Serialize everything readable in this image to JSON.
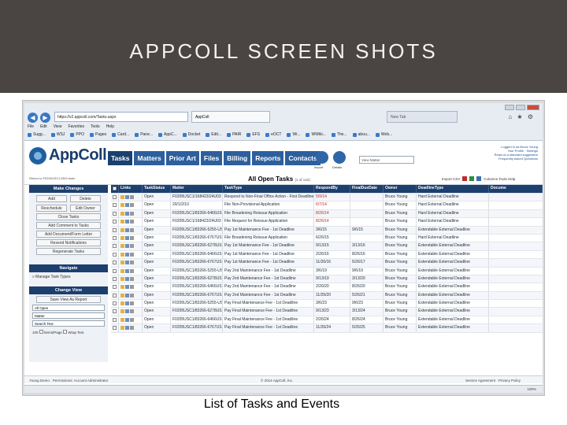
{
  "slide": {
    "title": "APPCOLL SCREEN SHOTS",
    "caption": "List of Tasks and Events"
  },
  "browser": {
    "url": "https://v2.appcoll.com/Tasks.aspx",
    "tab_title": "AppColl",
    "tab_new": "New Tab",
    "menu": [
      "File",
      "Edit",
      "View",
      "Favorites",
      "Tools",
      "Help"
    ],
    "favorites": [
      "Sugg...",
      "WSJ",
      "PPO",
      "Pages",
      "Card...",
      "Pane...",
      "AppC...",
      "Docket",
      "Edit...",
      "PAIR",
      "EFS",
      "eOCT",
      "Wi...",
      "WWiki...",
      "The...",
      "abou...",
      "Web..."
    ]
  },
  "app": {
    "logo_text": "AppColl",
    "tabs": [
      "Tasks",
      "Matters",
      "Prior Art",
      "Files",
      "Billing",
      "Reports",
      "Contacts"
    ],
    "import_label": "Import",
    "details_label": "Details",
    "search_placeholder": "View Matter",
    "user": {
      "logged_in": "Logged in as Bruce Young",
      "profile": "Your Profile · Settings",
      "support": "Read us a standard suggestion",
      "faq": "Frequently Asked Questions"
    },
    "return_link": "Return to F0205USC1/26/5 Aster",
    "list_title": "All Open Tasks",
    "list_count": "(1 of 142)",
    "list_tools": "Import CSV",
    "list_options": "Columns  Tools  Help"
  },
  "sidebar": {
    "make_changes": "Make Changes",
    "add": "Add",
    "delete": "Delete",
    "reschedule": "Reschedule",
    "edit_owner": "Edit Owner",
    "close_tasks": "Close Tasks",
    "add_comment": "Add Comment to Tasks",
    "add_document": "Add Document/Form Letter",
    "resend": "Resend Notifications",
    "regenerate": "Regenerate Tasks",
    "navigate": "Navigate",
    "manage_types": "Manage Task Types",
    "change_view": "Change View",
    "save_view": "Save View As Report",
    "filter_all": "All Open",
    "filter_matter": "Matter",
    "search_text": "Search Text",
    "rows_per_page": "100",
    "items_per_page": "Items/Page",
    "wrap_text": "Wrap Text"
  },
  "table": {
    "headers": [
      "",
      "Links",
      "TaskStatus",
      "Matter",
      "TaskType",
      "RespondBy",
      "FinalDueDate",
      "Owner",
      "DeadlineType",
      "Docume"
    ],
    "rows": [
      {
        "status": "Open",
        "matter": "F0205USC1/168423/24U03",
        "type": "Respond to Non-Final Office Action - First Deadline",
        "by": "5/9/14",
        "final": "",
        "owner": "Bruce Young",
        "dtype": "Hard External Deadline"
      },
      {
        "status": "Open",
        "matter": "20/1/2/10",
        "type": "File Non-Provisional Application",
        "by": "6/7/14",
        "final": "",
        "owner": "Bruce Young",
        "dtype": "Hard External Deadline"
      },
      {
        "status": "Open",
        "matter": "F0205USC1/83266-6466US",
        "type": "File Broadening Reissue Application",
        "by": "8/26/14",
        "final": "",
        "owner": "Bruce Young",
        "dtype": "Hard External Deadline"
      },
      {
        "status": "Open",
        "matter": "F0205USC1/168423/24U03",
        "type": "File Request for Reissue Application",
        "by": "8/26/14",
        "final": "",
        "owner": "Bruce Young",
        "dtype": "Hard External Deadline"
      },
      {
        "status": "Open",
        "matter": "F0205USC1/83266-5255-US",
        "type": "Pay 1st Maintenance Fee - 1st Deadline",
        "by": "3/6/15",
        "final": "9/6/15",
        "owner": "Bruce Young",
        "dtype": "Extendable External Deadline"
      },
      {
        "status": "Open",
        "matter": "F0205USC1/83266-6767US",
        "type": "File Broadening Reissue Application",
        "by": "6/26/15",
        "final": "",
        "owner": "Bruce Young",
        "dtype": "Hard External Deadline"
      },
      {
        "status": "Open",
        "matter": "F0205USC1/83266-6278US",
        "type": "Pay 1st Maintenance Fee - 1st Deadline",
        "by": "9/13/15",
        "final": "3/13/16",
        "owner": "Bruce Young",
        "dtype": "Extendable External Deadline"
      },
      {
        "status": "Open",
        "matter": "F0205USC1/83266-6466US",
        "type": "Pay 1st Maintenance Fee - 1st Deadline",
        "by": "2/26/16",
        "final": "8/26/16",
        "owner": "Bruce Young",
        "dtype": "Extendable External Deadline"
      },
      {
        "status": "Open",
        "matter": "F0205USC1/83266-6767US",
        "type": "Pay 1st Maintenance Fee - 1st Deadline",
        "by": "11/26/16",
        "final": "5/26/17",
        "owner": "Bruce Young",
        "dtype": "Extendable External Deadline"
      },
      {
        "status": "Open",
        "matter": "F0205USC1/83266-5255-US",
        "type": "Pay 2nd Maintenance Fee - 1st Deadline",
        "by": "3/6/19",
        "final": "9/6/19",
        "owner": "Bruce Young",
        "dtype": "Extendable External Deadline"
      },
      {
        "status": "Open",
        "matter": "F0205USC1/83266-6278US",
        "type": "Pay 2nd Maintenance Fee - 1st Deadline",
        "by": "9/13/19",
        "final": "3/13/20",
        "owner": "Bruce Young",
        "dtype": "Extendable External Deadline"
      },
      {
        "status": "Open",
        "matter": "F0205USC1/83266-6466US",
        "type": "Pay 2nd Maintenance Fee - 1st Deadline",
        "by": "2/26/20",
        "final": "8/26/20",
        "owner": "Bruce Young",
        "dtype": "Extendable External Deadline"
      },
      {
        "status": "Open",
        "matter": "F0205USC1/83266-6767US",
        "type": "Pay 2nd Maintenance Fee - 1st Deadline",
        "by": "11/26/20",
        "final": "5/26/21",
        "owner": "Bruce Young",
        "dtype": "Extendable External Deadline"
      },
      {
        "status": "Open",
        "matter": "F0205USC1/83266-5255-US",
        "type": "Pay Final Maintenance Fee - 1st Deadline",
        "by": "3/6/23",
        "final": "9/6/23",
        "owner": "Bruce Young",
        "dtype": "Extendable External Deadline"
      },
      {
        "status": "Open",
        "matter": "F0205USC1/83266-6278US",
        "type": "Pay Final Maintenance Fee - 1st Deadline",
        "by": "9/13/23",
        "final": "3/13/24",
        "owner": "Bruce Young",
        "dtype": "Extendable External Deadline"
      },
      {
        "status": "Open",
        "matter": "F0205USC1/83266-6466US",
        "type": "Pay Final Maintenance Fee - 1st Deadline",
        "by": "2/26/24",
        "final": "8/26/24",
        "owner": "Bruce Young",
        "dtype": "Extendable External Deadline"
      },
      {
        "status": "Open",
        "matter": "F0205USC1/83266-6767US",
        "type": "Pay Final Maintenance Fee - 1st Deadline",
        "by": "11/26/24",
        "final": "5/26/25",
        "owner": "Bruce Young",
        "dtype": "Extendable External Deadline"
      }
    ]
  },
  "footer": {
    "user": "Young Demo · Permissions: Account Administrator",
    "copyright": "© 2014 AppColl, Inc.",
    "links": "Service Agreement · Privacy Policy",
    "zoom": "100%"
  },
  "colors": {
    "banner": "#4a4442",
    "nav": "#1c3f6e",
    "tab": "#2d5f9d",
    "overdue": "#c0282a"
  }
}
